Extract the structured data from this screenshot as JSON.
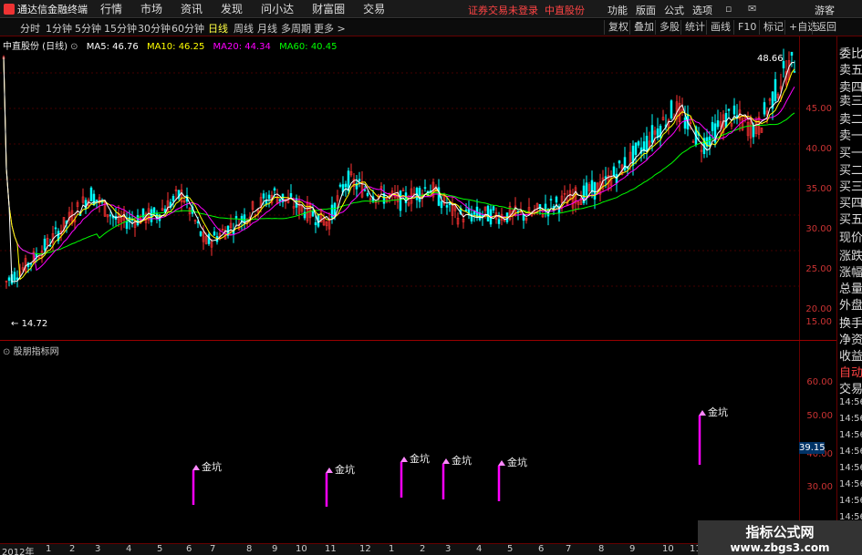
{
  "app": {
    "title": "通达信金融终端",
    "menus": [
      "行情",
      "市场",
      "资讯",
      "发现",
      "问小达",
      "财富圈",
      "交易"
    ],
    "status": "证券交易未登录",
    "stock_name_top": "中直股份",
    "right_menus": [
      "功能",
      "版面",
      "公式",
      "选项"
    ],
    "user": "游客"
  },
  "periods": [
    "分时",
    "1分钟",
    "5分钟",
    "15分钟",
    "30分钟",
    "60分钟",
    "日线",
    "周线",
    "月线",
    "多周期",
    "更多 >"
  ],
  "active_period": "日线",
  "tools": [
    "复权",
    "叠加",
    "多股",
    "统计",
    "画线",
    "F10",
    "标记",
    "+自选",
    "返回"
  ],
  "chart": {
    "title": "中直股份 (日线)",
    "ma5": "MA5: 46.76",
    "ma10": "MA10: 46.25",
    "ma20": "MA20: 44.34",
    "ma60": "MA60: 40.45",
    "high_label": "48.66",
    "low_label": "14.72",
    "colors": {
      "ma5": "#ffffff",
      "ma10": "#ffff00",
      "ma20": "#ff00ff",
      "ma60": "#00ff00",
      "up": "#ff3333",
      "down": "#00ffff"
    },
    "y_ticks": [
      "45.00",
      "40.00",
      "35.00",
      "30.00",
      "25.00",
      "20.00",
      "15.00"
    ]
  },
  "indicator": {
    "title": "股朋指标网",
    "y_ticks": [
      "60.00",
      "50.00",
      "40.00",
      "30.00"
    ],
    "value": "39.15",
    "signal": "金坑"
  },
  "right_panel": [
    "委比",
    "卖五",
    "卖四",
    "卖三",
    "卖二",
    "卖一",
    "买一",
    "买二",
    "买三",
    "买四",
    "买五",
    "现价",
    "涨跌",
    "涨幅",
    "总量",
    "外盘",
    "换手",
    "净资",
    "收益",
    "自动",
    "交易",
    "14:56",
    "14:56",
    "14:56",
    "14:56",
    "14:56",
    "14:56",
    "14:56",
    "14:56"
  ],
  "timeline": [
    "2012年",
    "1",
    "2",
    "3",
    "4",
    "5",
    "6",
    "7",
    "8",
    "9",
    "10",
    "11",
    "12",
    "1",
    "2",
    "3",
    "4",
    "5",
    "6",
    "7",
    "8",
    "9",
    "10",
    "11"
  ],
  "watermark": {
    "line1": "指标公式网",
    "line2": "www.zbgs3.com"
  }
}
